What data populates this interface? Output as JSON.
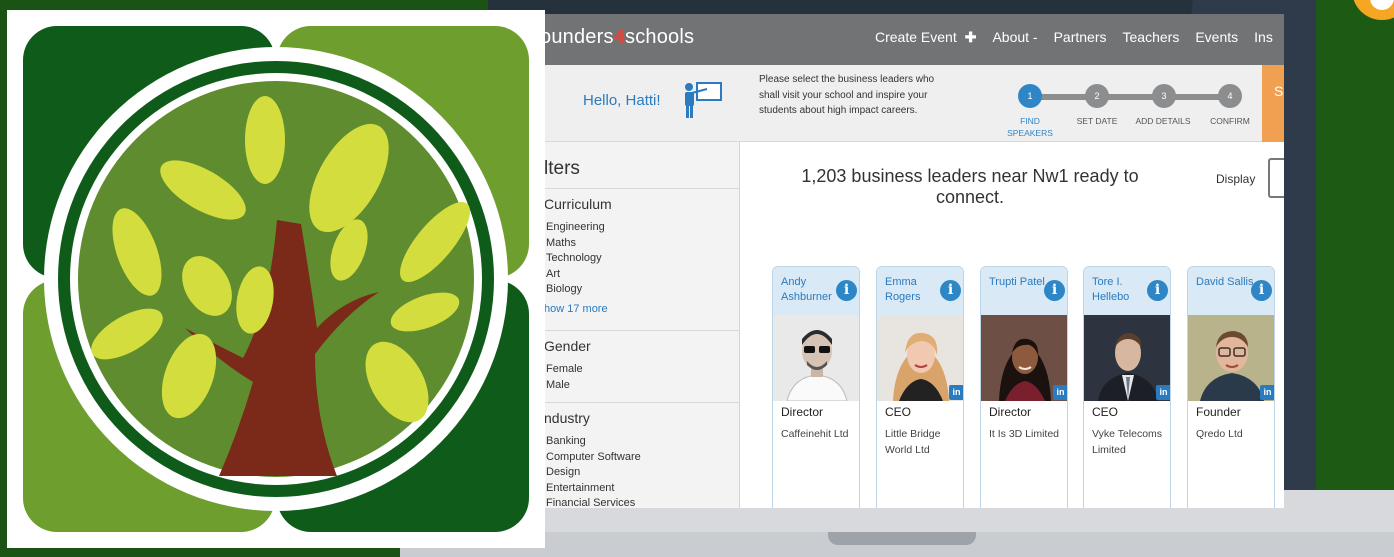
{
  "colors": {
    "accent": "#2f86c6",
    "nav_bg": "#717375",
    "brand_red": "#e0463a",
    "orange": "#f0a050",
    "leaf": "#d3de3e",
    "tree_green": "#5e8c2e",
    "trunk": "#7b2a19"
  },
  "nav": {
    "brand_prefix": "ounders",
    "brand_digit": "4",
    "brand_suffix": "schools",
    "create_event": "Create Event",
    "create_icon": "plus-icon",
    "about": "About -",
    "partners": "Partners",
    "teachers": "Teachers",
    "events": "Events",
    "cut_item": "Ins"
  },
  "subbar": {
    "greeting": "Hello, Hatti!",
    "icon": "teacher-board-icon",
    "prompt": "Please select the business leaders who shall visit your school and inspire your students about high impact careers.",
    "orange_tab_letter": "S",
    "steps": [
      {
        "num": "1",
        "label": "FIND SPEAKERS",
        "active": true
      },
      {
        "num": "2",
        "label": "SET DATE",
        "active": false
      },
      {
        "num": "3",
        "label": "ADD DETAILS",
        "active": false
      },
      {
        "num": "4",
        "label": "CONFIRM",
        "active": false
      }
    ]
  },
  "filters": {
    "title": "lters",
    "curriculum": {
      "title": "Curriculum",
      "items": [
        "Engineering",
        "Maths",
        "Technology",
        "Art",
        "Biology"
      ],
      "more": "how 17 more"
    },
    "gender": {
      "title": "Gender",
      "items": [
        "Female",
        "Male"
      ]
    },
    "industry": {
      "title": "ndustry",
      "items": [
        "Banking",
        "Computer Software",
        "Design",
        "Entertainment",
        "Financial Services"
      ]
    }
  },
  "results": {
    "title": "1,203 business leaders near Nw1 ready to connect.",
    "display_label": "Display"
  },
  "cards": [
    {
      "name": "Andy Ashburner",
      "role": "Director",
      "company": "Caffeinehit Ltd",
      "linkedin": false
    },
    {
      "name": "Emma Rogers",
      "role": "CEO",
      "company": "Little Bridge World Ltd",
      "linkedin": true
    },
    {
      "name": "Trupti Patel",
      "role": "Director",
      "company": "It Is 3D Limited",
      "linkedin": true
    },
    {
      "name": "Tore I. Hellebo",
      "role": "CEO",
      "company": "Vyke Telecoms Limited",
      "linkedin": true
    },
    {
      "name": "David Sallis",
      "role": "Founder",
      "company": "Qredo Ltd",
      "linkedin": true
    }
  ],
  "card_icons": {
    "info": "info-icon",
    "linkedin": "linkedin-icon"
  },
  "info_glyph": "i",
  "linkedin_glyph": "in"
}
